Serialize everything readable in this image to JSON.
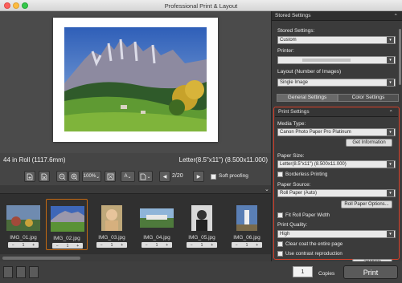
{
  "window": {
    "title": "Professional Print & Layout"
  },
  "preview": {
    "roll_info": "44 in Roll (1117.6mm)",
    "paper_info": "Letter(8.5\"x11\") (8.500x11.000)"
  },
  "toolbar": {
    "zoom_value": "100%",
    "page_indicator": "2/20",
    "soft_proofing_label": "Soft proofing"
  },
  "thumbnails": [
    {
      "name": "IMG_01.jpg",
      "count": "1"
    },
    {
      "name": "IMG_02.jpg",
      "count": "1"
    },
    {
      "name": "IMG_03.jpg",
      "count": "1"
    },
    {
      "name": "IMG_04.jpg",
      "count": "1"
    },
    {
      "name": "IMG_05.jpg",
      "count": "1"
    },
    {
      "name": "IMG_06.jpg",
      "count": "1"
    }
  ],
  "stored_settings": {
    "header": "Stored Settings",
    "label": "Stored Settings:",
    "value": "Custom",
    "printer_label": "Printer:",
    "layout_label": "Layout (Number of Images)",
    "layout_value": "Single Image"
  },
  "tabs": {
    "general": "General Settings",
    "color": "Color Settings"
  },
  "print_settings": {
    "header": "Print Settings",
    "media_type_label": "Media Type:",
    "media_type_value": "Canon Photo Paper Pro Platinum",
    "get_info_button": "Get Information",
    "paper_size_label": "Paper Size:",
    "paper_size_value": "Letter(8.5\"x11\") (8.500x11.000)",
    "borderless_label": "Borderless Printing",
    "paper_source_label": "Paper Source:",
    "paper_source_value": "Roll Paper (Auto)",
    "roll_paper_options_button": "Roll Paper Options...",
    "fit_roll_label": "Fit Roll Paper Width",
    "print_quality_label": "Print Quality:",
    "print_quality_value": "High",
    "clear_coat_label": "Clear coat the entire page",
    "contrast_label": "Use contrast reproduction",
    "settings_button": "Settings"
  },
  "bottom": {
    "copies_value": "1",
    "copies_label": "Copies",
    "print_button": "Print"
  },
  "icons": [
    "add-page-icon",
    "remove-page-icon",
    "zoom-out-icon",
    "zoom-in-icon",
    "fit-icon",
    "text-icon",
    "page-setup-icon",
    "prev-page-icon",
    "next-page-icon",
    "chevron-down-icon",
    "view-mode-icon"
  ]
}
